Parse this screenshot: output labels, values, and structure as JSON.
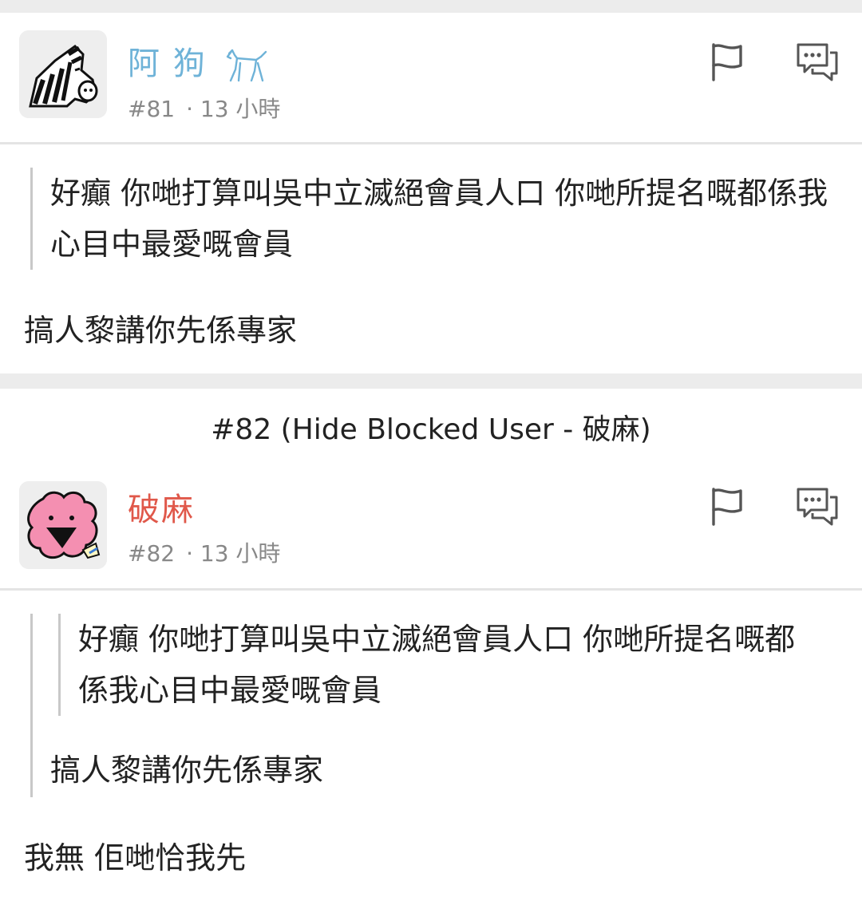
{
  "posts": [
    {
      "username": "阿 狗",
      "username_color": "#6fb3d8",
      "post_number": "#81",
      "time": "· 13 小時",
      "quote": "好癲 你哋打算叫吳中立滅絕會員人口 你哋所提名嘅都係我心目中最愛嘅會員",
      "reply": "搞人黎講你先係專家",
      "avatar_icon": "zebra-avatar",
      "gender_icon": "dog-icon"
    },
    {
      "blocked_note": "#82 (Hide Blocked User - 破麻)",
      "username": "破麻",
      "username_color": "#e0584a",
      "post_number": "#82",
      "time": "· 13 小時",
      "nested_quote": "好癲 你哋打算叫吳中立滅絕會員人口 你哋所提名嘅都係我心目中最愛嘅會員",
      "quote": "搞人黎講你先係專家",
      "reply": "我無 佢哋恰我先",
      "avatar_icon": "pink-blob-avatar"
    }
  ],
  "icons": {
    "report": "flag-icon",
    "reply": "comment-icon"
  }
}
